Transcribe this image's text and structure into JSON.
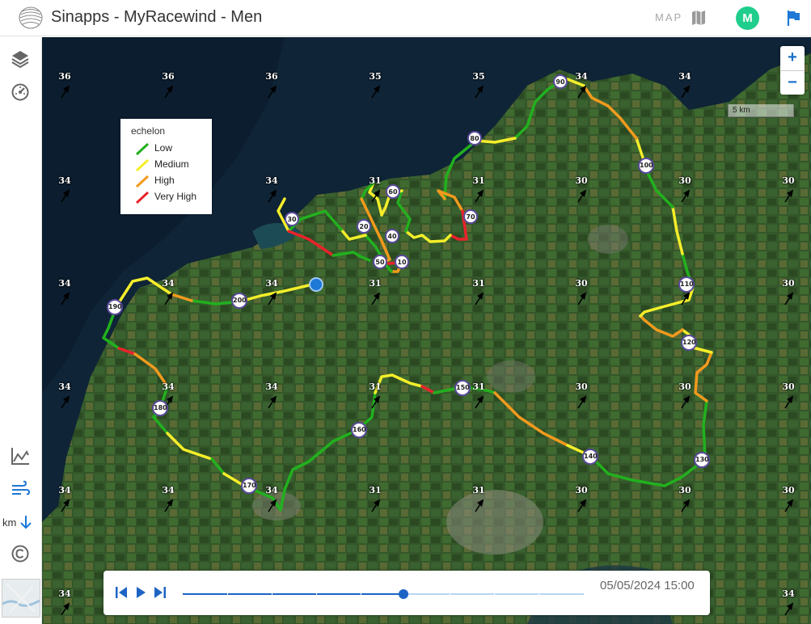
{
  "header": {
    "title": "Sinapps - MyRacewind - Men",
    "map_label": "MAP",
    "avatar_initial": "M"
  },
  "sidebar": {
    "items": [
      {
        "name": "layers-icon"
      },
      {
        "name": "speedometer-icon"
      },
      {
        "name": "chart-icon"
      },
      {
        "name": "wind-icon"
      },
      {
        "name": "copyright-icon"
      }
    ],
    "unit_label": "km"
  },
  "legend": {
    "title": "echelon",
    "items": [
      {
        "label": "Low",
        "color": "#22b01e"
      },
      {
        "label": "Medium",
        "color": "#f4ee2a"
      },
      {
        "label": "High",
        "color": "#f29a1d"
      },
      {
        "label": "Very High",
        "color": "#e8232b"
      }
    ]
  },
  "map": {
    "scale_label": "5 km",
    "zoom_in": "+",
    "zoom_out": "−",
    "wind_values": {
      "row1": [
        "36",
        "36",
        "36",
        "35",
        "35",
        "34",
        "34"
      ],
      "row2": [
        "34",
        "34",
        "31",
        "31",
        "30",
        "30",
        "30"
      ],
      "row3": [
        "34",
        "34",
        "34",
        "31",
        "31",
        "30",
        "30",
        "30"
      ],
      "row4": [
        "34",
        "34",
        "34",
        "31",
        "31",
        "30",
        "30",
        "30"
      ],
      "row5": [
        "34",
        "34",
        "34",
        "31",
        "31",
        "30",
        "30",
        "30"
      ],
      "row6": [
        "34",
        "34"
      ]
    },
    "km_markers": [
      "10",
      "20",
      "30",
      "40",
      "50",
      "60",
      "70",
      "80",
      "90",
      "100",
      "110",
      "120",
      "130",
      "140",
      "150",
      "160",
      "170",
      "180",
      "190",
      "200"
    ]
  },
  "player": {
    "datetime": "05/05/2024 15:00",
    "progress": 0.55
  }
}
